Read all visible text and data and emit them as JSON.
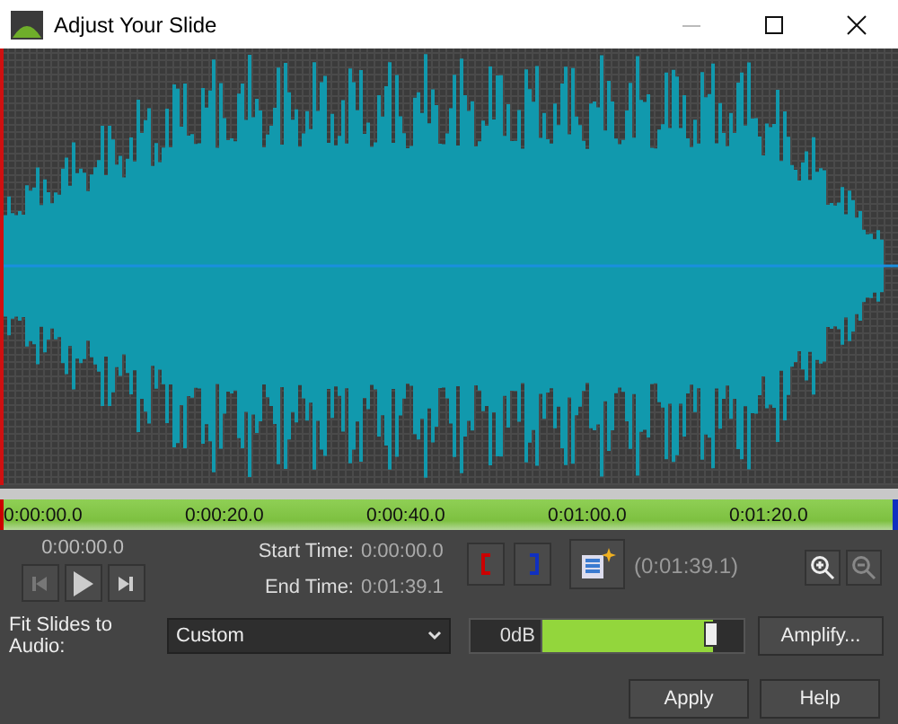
{
  "window": {
    "title": "Adjust Your Slide"
  },
  "timeline": {
    "labels": [
      "0:00:00.0",
      "0:00:20.0",
      "0:00:40.0",
      "0:01:00.0",
      "0:01:20.0"
    ]
  },
  "playback": {
    "current_time": "0:00:00.0"
  },
  "start_time": {
    "label": "Start Time:",
    "value": "0:00:00.0"
  },
  "end_time": {
    "label": "End Time:",
    "value": "0:01:39.1"
  },
  "duration": "(0:01:39.1)",
  "fit_slides": {
    "label": "Fit Slides to Audio:",
    "value": "Custom"
  },
  "volume": {
    "reading": "0dB",
    "level": 0.85
  },
  "buttons": {
    "amplify": "Amplify...",
    "apply": "Apply",
    "help": "Help"
  }
}
